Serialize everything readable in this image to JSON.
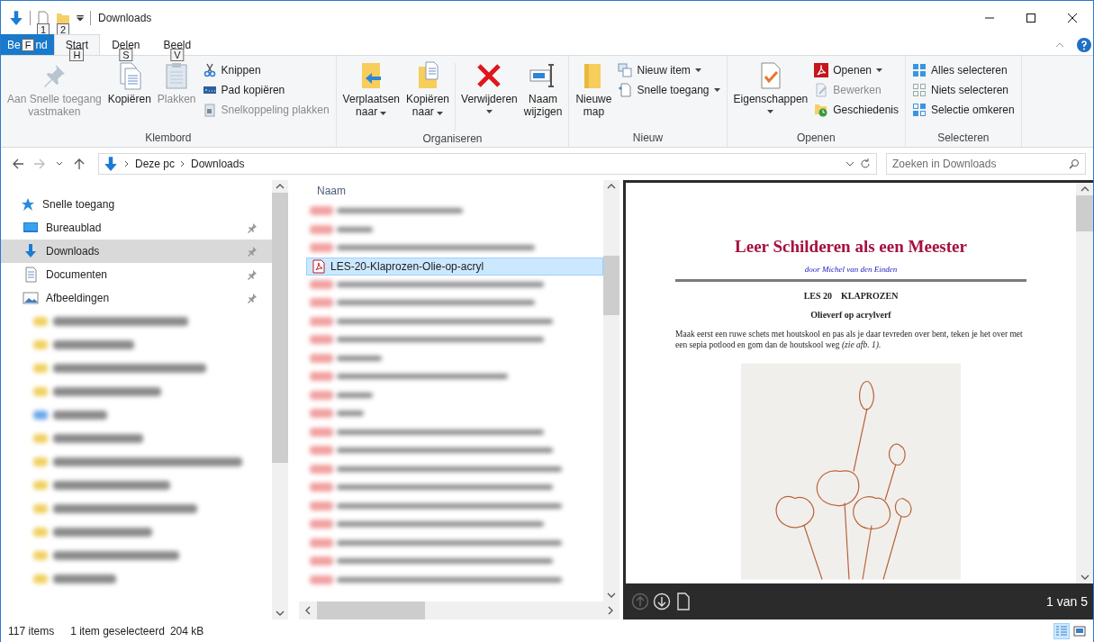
{
  "window": {
    "title": "Downloads",
    "keytips": [
      "1",
      "2"
    ]
  },
  "ribbon_tabs": [
    {
      "kind": "file",
      "label_before": "Be",
      "label_after": "nd",
      "keytip": "F",
      "selected": false
    },
    {
      "kind": "tab",
      "label": "Start",
      "keytip": "H",
      "selected": true
    },
    {
      "kind": "tab",
      "label": "Delen",
      "keytip": "S",
      "selected": false
    },
    {
      "kind": "tab",
      "label": "Beeld",
      "keytip": "V",
      "selected": false
    }
  ],
  "ribbon_groups": [
    {
      "name": "Klembord",
      "items": [
        {
          "kind": "large",
          "lines": [
            "Aan Snelle toegang",
            "vastmaken"
          ],
          "disabled": true,
          "dropdown": false
        },
        {
          "kind": "large",
          "lines": [
            "Kopiëren"
          ],
          "disabled": false,
          "dropdown": false
        },
        {
          "kind": "large",
          "lines": [
            "Plakken"
          ],
          "disabled": true,
          "dropdown": false
        },
        {
          "kind": "stack",
          "items": [
            {
              "label": "Knippen",
              "disabled": false,
              "dropdown": false
            },
            {
              "label": "Pad kopiëren",
              "disabled": false,
              "dropdown": false
            },
            {
              "label": "Snelkoppeling plakken",
              "disabled": true,
              "dropdown": false
            }
          ]
        }
      ]
    },
    {
      "name": "Organiseren",
      "items": [
        {
          "kind": "large",
          "lines": [
            "Verplaatsen",
            "naar"
          ],
          "disabled": false,
          "dropdown": true
        },
        {
          "kind": "large",
          "lines": [
            "Kopiëren",
            "naar"
          ],
          "disabled": false,
          "dropdown": true
        },
        {
          "kind": "separator"
        },
        {
          "kind": "large",
          "lines": [
            "Verwijderen"
          ],
          "disabled": false,
          "dropdown": true
        },
        {
          "kind": "large",
          "lines": [
            "Naam",
            "wijzigen"
          ],
          "disabled": false,
          "dropdown": false
        }
      ]
    },
    {
      "name": "Nieuw",
      "items": [
        {
          "kind": "large",
          "lines": [
            "Nieuwe",
            "map"
          ],
          "disabled": false,
          "dropdown": false
        },
        {
          "kind": "stack",
          "items": [
            {
              "label": "Nieuw item",
              "disabled": false,
              "dropdown": true
            },
            {
              "label": "Snelle toegang",
              "disabled": false,
              "dropdown": true
            }
          ]
        }
      ]
    },
    {
      "name": "Openen",
      "items": [
        {
          "kind": "large",
          "lines": [
            "Eigenschappen"
          ],
          "disabled": false,
          "dropdown": true
        },
        {
          "kind": "stack",
          "items": [
            {
              "label": "Openen",
              "disabled": false,
              "dropdown": true
            },
            {
              "label": "Bewerken",
              "disabled": true,
              "dropdown": false
            },
            {
              "label": "Geschiedenis",
              "disabled": false,
              "dropdown": false
            }
          ]
        }
      ]
    },
    {
      "name": "Selecteren",
      "items": [
        {
          "kind": "stack",
          "items": [
            {
              "label": "Alles selecteren",
              "disabled": false,
              "dropdown": false
            },
            {
              "label": "Niets selecteren",
              "disabled": false,
              "dropdown": false
            },
            {
              "label": "Selectie omkeren",
              "disabled": false,
              "dropdown": false
            }
          ]
        }
      ]
    }
  ],
  "address_bar": {
    "breadcrumb": [
      "Deze pc",
      "Downloads"
    ],
    "search": {
      "placeholder": "Zoeken in Downloads"
    }
  },
  "navigation_pane": {
    "items": [
      {
        "label": "Snelle toegang",
        "selected": false,
        "children": [
          {
            "label": "Bureaublad",
            "pinned": true,
            "selected": false
          },
          {
            "label": "Downloads",
            "pinned": true,
            "selected": true
          },
          {
            "label": "Documenten",
            "pinned": true,
            "selected": false
          },
          {
            "label": "Afbeeldingen",
            "pinned": true,
            "selected": false
          }
        ]
      }
    ],
    "other_items": [
      {
        "kind": "blurred"
      },
      {
        "kind": "blurred"
      },
      {
        "kind": "blurred"
      },
      {
        "kind": "blurred"
      },
      {
        "kind": "blurred"
      },
      {
        "kind": "blurred"
      },
      {
        "kind": "blurred"
      },
      {
        "kind": "blurred"
      },
      {
        "kind": "blurred"
      },
      {
        "kind": "blurred"
      },
      {
        "kind": "blurred"
      },
      {
        "kind": "blurred"
      }
    ]
  },
  "file_list": {
    "columns": [
      "Naam"
    ],
    "rows": [
      {
        "kind": "blurred"
      },
      {
        "kind": "blurred"
      },
      {
        "kind": "blurred"
      },
      {
        "kind": "file",
        "name": "LES-20-Klaprozen-Olie-op-acryl",
        "selected": true
      },
      {
        "kind": "blurred"
      },
      {
        "kind": "blurred"
      },
      {
        "kind": "blurred"
      },
      {
        "kind": "blurred"
      },
      {
        "kind": "blurred"
      },
      {
        "kind": "blurred"
      },
      {
        "kind": "blurred"
      },
      {
        "kind": "blurred"
      },
      {
        "kind": "blurred"
      },
      {
        "kind": "blurred"
      },
      {
        "kind": "blurred"
      },
      {
        "kind": "blurred"
      },
      {
        "kind": "blurred"
      },
      {
        "kind": "blurred"
      },
      {
        "kind": "blurred"
      },
      {
        "kind": "blurred"
      },
      {
        "kind": "blurred"
      }
    ]
  },
  "preview": {
    "title": "Leer Schilderen als een Meester",
    "author": "door Michel van den Einden",
    "heading": "LES 20    KLAPROZEN",
    "subheading": "Olieverf op acrylverf",
    "paragraph": "Maak eerst een ruwe schets met houtskool en pas als je daar tevreden over bent, teken je het over met een sepia potlood en gom dan de houtskool weg *(zie afb. 1)*.",
    "page_indicator": "1 van 5"
  },
  "status_bar": {
    "item_count": "117 items",
    "selection": "1 item geselecteerd",
    "size": "204 kB",
    "views": [
      {
        "kind": "details",
        "selected": true
      },
      {
        "kind": "large_icons",
        "selected": false
      }
    ]
  }
}
